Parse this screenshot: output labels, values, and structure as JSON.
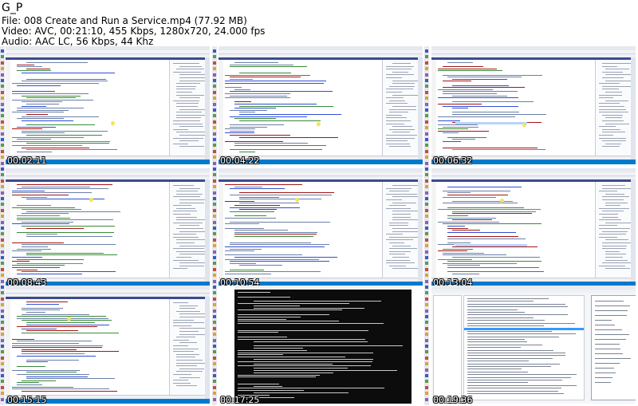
{
  "header": {
    "title": "G_P",
    "file": "File: 008 Create and Run a Service.mp4 (77.92 MB)",
    "video": "Video: AVC, 00:21:10, 455 Kbps, 1280x720, 24.000 fps",
    "audio": "Audio: AAC LC, 56 Kbps, 44 Khz"
  },
  "thumbnails": [
    {
      "kind": "vs",
      "timestamp": "00:02:11"
    },
    {
      "kind": "vs",
      "timestamp": "00:04:22"
    },
    {
      "kind": "vs",
      "timestamp": "00:06:32"
    },
    {
      "kind": "vs",
      "timestamp": "00:08:43"
    },
    {
      "kind": "vs",
      "timestamp": "00:10:54"
    },
    {
      "kind": "vs",
      "timestamp": "00:13:04"
    },
    {
      "kind": "vs",
      "timestamp": "00:15:15"
    },
    {
      "kind": "console",
      "timestamp": "00:17:25"
    },
    {
      "kind": "services",
      "timestamp": "00:19:36"
    }
  ],
  "colors": {
    "vs_tab_accent": "#3c4a8f",
    "vs_statusbar": "#007acc",
    "left_taskbar": "#243a79",
    "console_bg": "#0c0c0c",
    "selection_highlight": "#3399ff"
  }
}
